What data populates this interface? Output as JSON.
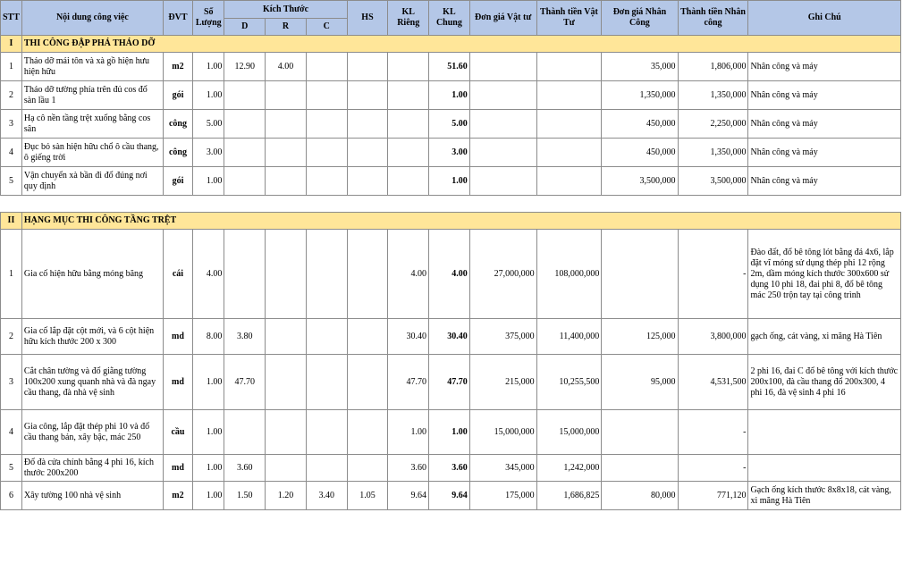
{
  "headers": {
    "stt": "STT",
    "noi_dung": "Nội dung công việc",
    "dvt": "ĐVT",
    "so_luong": "Số Lượng",
    "kich_thuoc": "Kích Thước",
    "d": "D",
    "r": "R",
    "c": "C",
    "hs": "HS",
    "kl_rieng": "KL Riêng",
    "kl_chung": "KL Chung",
    "don_gia_vat_tu": "Đơn giá Vật tư",
    "thanh_tien_vat_tu": "Thành tiền Vật Tư",
    "don_gia_nhan_cong": "Đơn giá Nhân Công",
    "thanh_tien_nhan_cong": "Thành tiền Nhân công",
    "ghi_chu": "Ghi Chú"
  },
  "section1": {
    "num": "I",
    "title": "THI CÔNG ĐẬP PHÁ THÁO DỠ",
    "rows": [
      {
        "stt": "1",
        "name": "Tháo dỡ mái tôn và xà gồ hiện hưu  hiện hữu",
        "dvt": "m2",
        "sl": "1.00",
        "d": "12.90",
        "r": "4.00",
        "c": "",
        "hs": "",
        "klr": "",
        "klc": "51.60",
        "dgvt": "",
        "ttvt": "",
        "dgnc": "35,000",
        "ttnc": "1,806,000",
        "ghichu": "Nhân công và máy"
      },
      {
        "stt": "2",
        "name": "Tháo dỡ tường phía trên đủ cos đổ sàn lầu 1",
        "dvt": "gói",
        "sl": "1.00",
        "d": "",
        "r": "",
        "c": "",
        "hs": "",
        "klr": "",
        "klc": "1.00",
        "dgvt": "",
        "ttvt": "",
        "dgnc": "1,350,000",
        "ttnc": "1,350,000",
        "ghichu": "Nhân công và máy"
      },
      {
        "stt": "3",
        "name": "Hạ cô nền tầng trệt xuống bằng cos sân",
        "dvt": "công",
        "sl": "5.00",
        "d": "",
        "r": "",
        "c": "",
        "hs": "",
        "klr": "",
        "klc": "5.00",
        "dgvt": "",
        "ttvt": "",
        "dgnc": "450,000",
        "ttnc": "2,250,000",
        "ghichu": "Nhân công và máy"
      },
      {
        "stt": "4",
        "name": "Đục bỏ sàn hiện hữu chổ ô cầu thang, ô giếng trời",
        "dvt": "công",
        "sl": "3.00",
        "d": "",
        "r": "",
        "c": "",
        "hs": "",
        "klr": "",
        "klc": "3.00",
        "dgvt": "",
        "ttvt": "",
        "dgnc": "450,000",
        "ttnc": "1,350,000",
        "ghichu": "Nhân công và máy"
      },
      {
        "stt": "5",
        "name": "Vận chuyển xà bần đi đổ đúng nơi quy định",
        "dvt": "gói",
        "sl": "1.00",
        "d": "",
        "r": "",
        "c": "",
        "hs": "",
        "klr": "",
        "klc": "1.00",
        "dgvt": "",
        "ttvt": "",
        "dgnc": "3,500,000",
        "ttnc": "3,500,000",
        "ghichu": "Nhân công và máy"
      }
    ]
  },
  "section2": {
    "num": "II",
    "title": "HẠNG MỤC THI CÔNG TẦNG TRỆT",
    "rows": [
      {
        "stt": "1",
        "name": "Gia cố hiện hữu bằng móng băng",
        "dvt": "cái",
        "sl": "4.00",
        "d": "",
        "r": "",
        "c": "",
        "hs": "",
        "klr": "4.00",
        "klc": "4.00",
        "dgvt": "27,000,000",
        "ttvt": "108,000,000",
        "dgnc": "",
        "ttnc": "-",
        "ghichu": "Đào đất, đổ bê tông lót bằng đá 4x6, lắp đặt vĩ móng sử dụng thép phi 12 rộng 2m, dầm móng kích thước 300x600 sử dụng 10 phi 18, đai phi 8, đổ bê tông mác 250 trộn tay tại công trình"
      },
      {
        "stt": "2",
        "name": "Gia cố lắp đặt cột mới, và 6 cột hiện hữu kích thước 200 x 300",
        "dvt": "md",
        "sl": "8.00",
        "d": "3.80",
        "r": "",
        "c": "",
        "hs": "",
        "klr": "30.40",
        "klc": "30.40",
        "dgvt": "375,000",
        "ttvt": "11,400,000",
        "dgnc": "125,000",
        "ttnc": "3,800,000",
        "ghichu": "gạch ống, cát vàng, xi măng Hà Tiên"
      },
      {
        "stt": "3",
        "name": "Cắt chân tường và đổ giằng tường  100x200 xung quanh nhà và đà ngay cầu thang, đà nhà vệ sinh",
        "dvt": "md",
        "sl": "1.00",
        "d": "47.70",
        "r": "",
        "c": "",
        "hs": "",
        "klr": "47.70",
        "klc": "47.70",
        "dgvt": "215,000",
        "ttvt": "10,255,500",
        "dgnc": "95,000",
        "ttnc": "4,531,500",
        "ghichu": "2 phi 16, đai C đổ bê tông với kích thước 200x100, đà cầu thang đổ 200x300, 4 phi 16, đà vệ sinh 4 phi 16"
      },
      {
        "stt": "4",
        "name": "Gia công, lắp đặt thép phi 10 và đổ cầu thang bản, xây bậc, mác 250",
        "dvt": "cầu",
        "sl": "1.00",
        "d": "",
        "r": "",
        "c": "",
        "hs": "",
        "klr": "1.00",
        "klc": "1.00",
        "dgvt": "15,000,000",
        "ttvt": "15,000,000",
        "dgnc": "",
        "ttnc": "-",
        "ghichu": ""
      },
      {
        "stt": "5",
        "name": "Đổ đà cửa chính bằng 4 phi 16, kích thước 200x200",
        "dvt": "md",
        "sl": "1.00",
        "d": "3.60",
        "r": "",
        "c": "",
        "hs": "",
        "klr": "3.60",
        "klc": "3.60",
        "dgvt": "345,000",
        "ttvt": "1,242,000",
        "dgnc": "",
        "ttnc": "-",
        "ghichu": ""
      },
      {
        "stt": "6",
        "name": "Xây tường 100 nhà vệ sinh",
        "dvt": "m2",
        "sl": "1.00",
        "d": "1.50",
        "r": "1.20",
        "c": "3.40",
        "hs": "1.05",
        "klr": "9.64",
        "klc": "9.64",
        "dgvt": "175,000",
        "ttvt": "1,686,825",
        "dgnc": "80,000",
        "ttnc": "771,120",
        "ghichu": "Gạch ống kích thước 8x8x18, cát vàng, xi măng Hà Tiên"
      }
    ]
  }
}
